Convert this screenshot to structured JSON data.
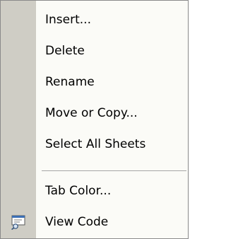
{
  "context_menu": {
    "items": [
      {
        "key": "insert",
        "label": "Insert..."
      },
      {
        "key": "delete",
        "label": "Delete"
      },
      {
        "key": "rename",
        "label": "Rename"
      },
      {
        "key": "move_copy",
        "label": "Move or Copy..."
      },
      {
        "key": "select_all_sheets",
        "label": "Select All Sheets"
      },
      {
        "key": "tab_color",
        "label": "Tab Color..."
      },
      {
        "key": "view_code",
        "label": "View Code",
        "icon": "view-code-icon"
      }
    ],
    "colors": {
      "gutter": "#cfcdc5",
      "background": "#fbfbf7",
      "separator": "#a6a6a6",
      "border": "#8a8a8a"
    }
  }
}
